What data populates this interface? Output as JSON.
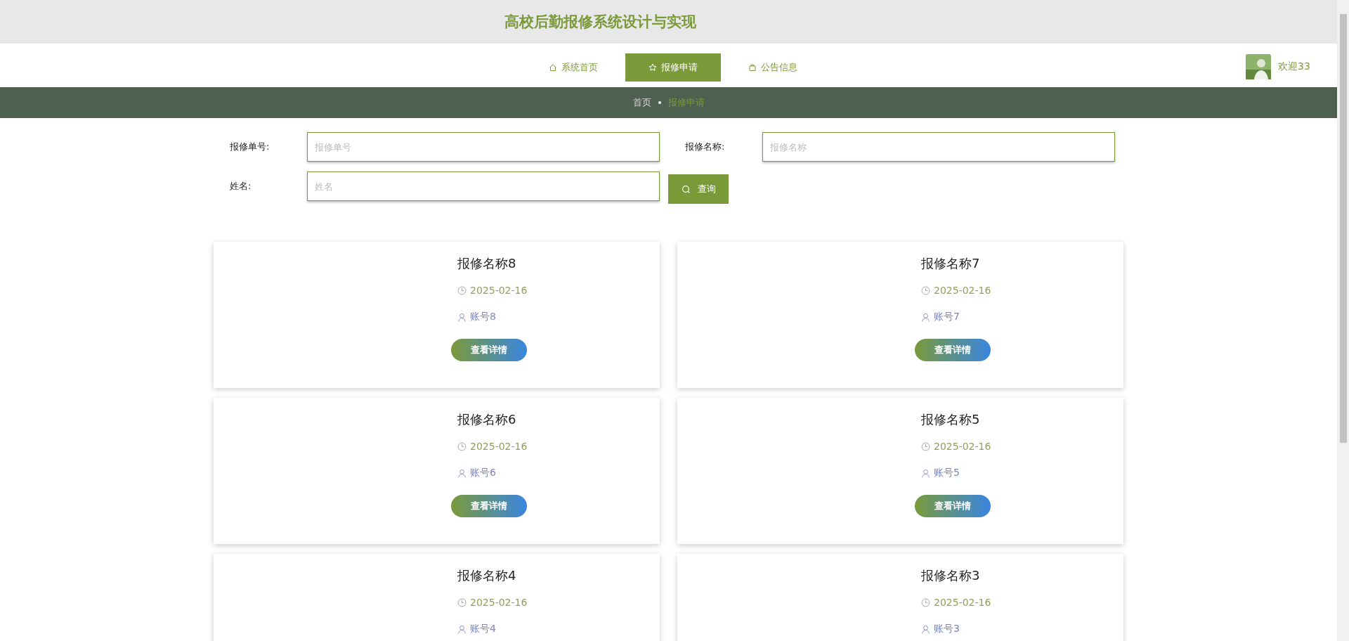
{
  "header": {
    "title": "高校后勤报修系统设计与实现"
  },
  "nav": {
    "tabs": [
      {
        "label": "系统首页",
        "selected": false
      },
      {
        "label": "报修申请",
        "selected": true
      },
      {
        "label": "公告信息",
        "selected": false
      }
    ],
    "user": {
      "greeting": "欢迎33"
    }
  },
  "breadcrumb": [
    {
      "label": "首页",
      "current": false
    },
    {
      "label": "报修申请",
      "current": true
    }
  ],
  "search": {
    "fields": [
      {
        "label": "报修单号:",
        "placeholder": "报修单号"
      },
      {
        "label": "报修名称:",
        "placeholder": "报修名称"
      },
      {
        "label": "姓名:",
        "placeholder": "姓名"
      }
    ],
    "button": "查询"
  },
  "cards": [
    {
      "title": "报修名称8",
      "date": "2025-02-16",
      "account": "账号8",
      "button": "查看详情"
    },
    {
      "title": "报修名称7",
      "date": "2025-02-16",
      "account": "账号7",
      "button": "查看详情"
    },
    {
      "title": "报修名称6",
      "date": "2025-02-16",
      "account": "账号6",
      "button": "查看详情"
    },
    {
      "title": "报修名称5",
      "date": "2025-02-16",
      "account": "账号5",
      "button": "查看详情"
    },
    {
      "title": "报修名称4",
      "date": "2025-02-16",
      "account": "账号4"
    },
    {
      "title": "报修名称3",
      "date": "2025-02-16",
      "account": "账号3"
    }
  ]
}
